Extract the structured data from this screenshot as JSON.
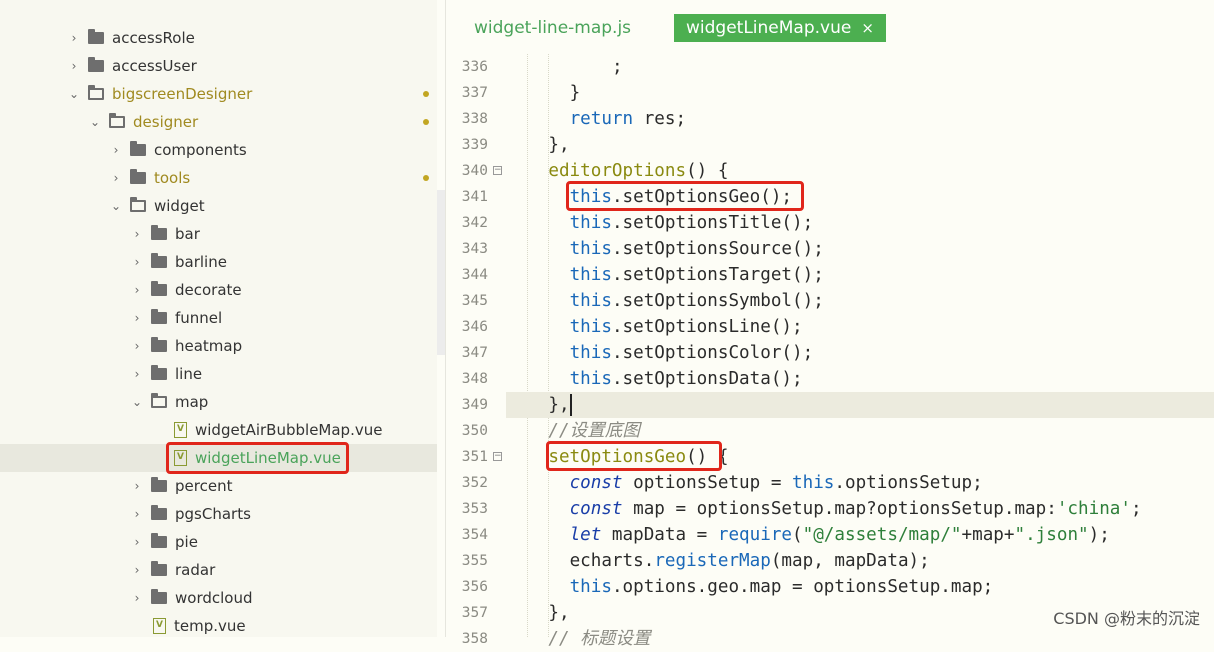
{
  "sidebar": {
    "rows": [
      {
        "label": "accessRole"
      },
      {
        "label": "accessUser"
      },
      {
        "label": "bigscreenDesigner"
      },
      {
        "label": "designer"
      },
      {
        "label": "components"
      },
      {
        "label": "tools"
      },
      {
        "label": "widget"
      },
      {
        "label": "bar"
      },
      {
        "label": "barline"
      },
      {
        "label": "decorate"
      },
      {
        "label": "funnel"
      },
      {
        "label": "heatmap"
      },
      {
        "label": "line"
      },
      {
        "label": "map"
      },
      {
        "label": "widgetAirBubbleMap.vue"
      },
      {
        "label": "widgetLineMap.vue"
      },
      {
        "label": "percent"
      },
      {
        "label": "pgsCharts"
      },
      {
        "label": "pie"
      },
      {
        "label": "radar"
      },
      {
        "label": "wordcloud"
      },
      {
        "label": "temp.vue"
      }
    ],
    "file_icon_letter": "V",
    "colors": {
      "green": "#4aa35a",
      "modified_dot": "#c2a622",
      "highlight": "#e0261b"
    }
  },
  "tabs": {
    "tab1": "widget-line-map.js",
    "tab2": "widgetLineMap.vue",
    "close_glyph": "×"
  },
  "editor": {
    "line_numbers": [
      "336",
      "337",
      "338",
      "339",
      "340",
      "341",
      "342",
      "343",
      "344",
      "345",
      "346",
      "347",
      "348",
      "349",
      "350",
      "351",
      "352",
      "353",
      "354",
      "355",
      "356",
      "357",
      "358"
    ],
    "fold_glyph": "−",
    "code": {
      "l336": ";",
      "l337": "}",
      "l338_kw": "return",
      "l338_rest": " res;",
      "l339": "},",
      "l340_fn": "editorOptions",
      "l340_rest": "() {",
      "l341_this": "this",
      "l341_call": ".setOptionsGeo();",
      "l342_this": "this",
      "l342_call": ".setOptionsTitle();",
      "l343_this": "this",
      "l343_call": ".setOptionsSource();",
      "l344_this": "this",
      "l344_call": ".setOptionsTarget();",
      "l345_this": "this",
      "l345_call": ".setOptionsSymbol();",
      "l346_this": "this",
      "l346_call": ".setOptionsLine();",
      "l347_this": "this",
      "l347_call": ".setOptionsColor();",
      "l348_this": "this",
      "l348_call": ".setOptionsData();",
      "l349": "},",
      "l350_comment": "//设置底图",
      "l351_fn": "setOptionsGeo",
      "l351_rest": "() {",
      "l352_kw": "const",
      "l352_a": " optionsSetup = ",
      "l352_this": "this",
      "l352_b": ".optionsSetup;",
      "l353_kw": "const",
      "l353_a": " map = optionsSetup.map?optionsSetup.map:",
      "l353_str": "'china'",
      "l353_b": ";",
      "l354_kw": "let",
      "l354_a": " mapData = ",
      "l354_req": "require",
      "l354_b": "(",
      "l354_s1": "\"@/assets/map/\"",
      "l354_c": "+map+",
      "l354_s2": "\".json\"",
      "l354_d": ");",
      "l355_a": "echarts.",
      "l355_fn": "registerMap",
      "l355_b": "(map, mapData);",
      "l356_this": "this",
      "l356_a": ".options.geo.map = optionsSetup.map;",
      "l357": "},",
      "l358_comment": "// 标题设置"
    }
  },
  "watermark": "CSDN @粉末的沉淀"
}
